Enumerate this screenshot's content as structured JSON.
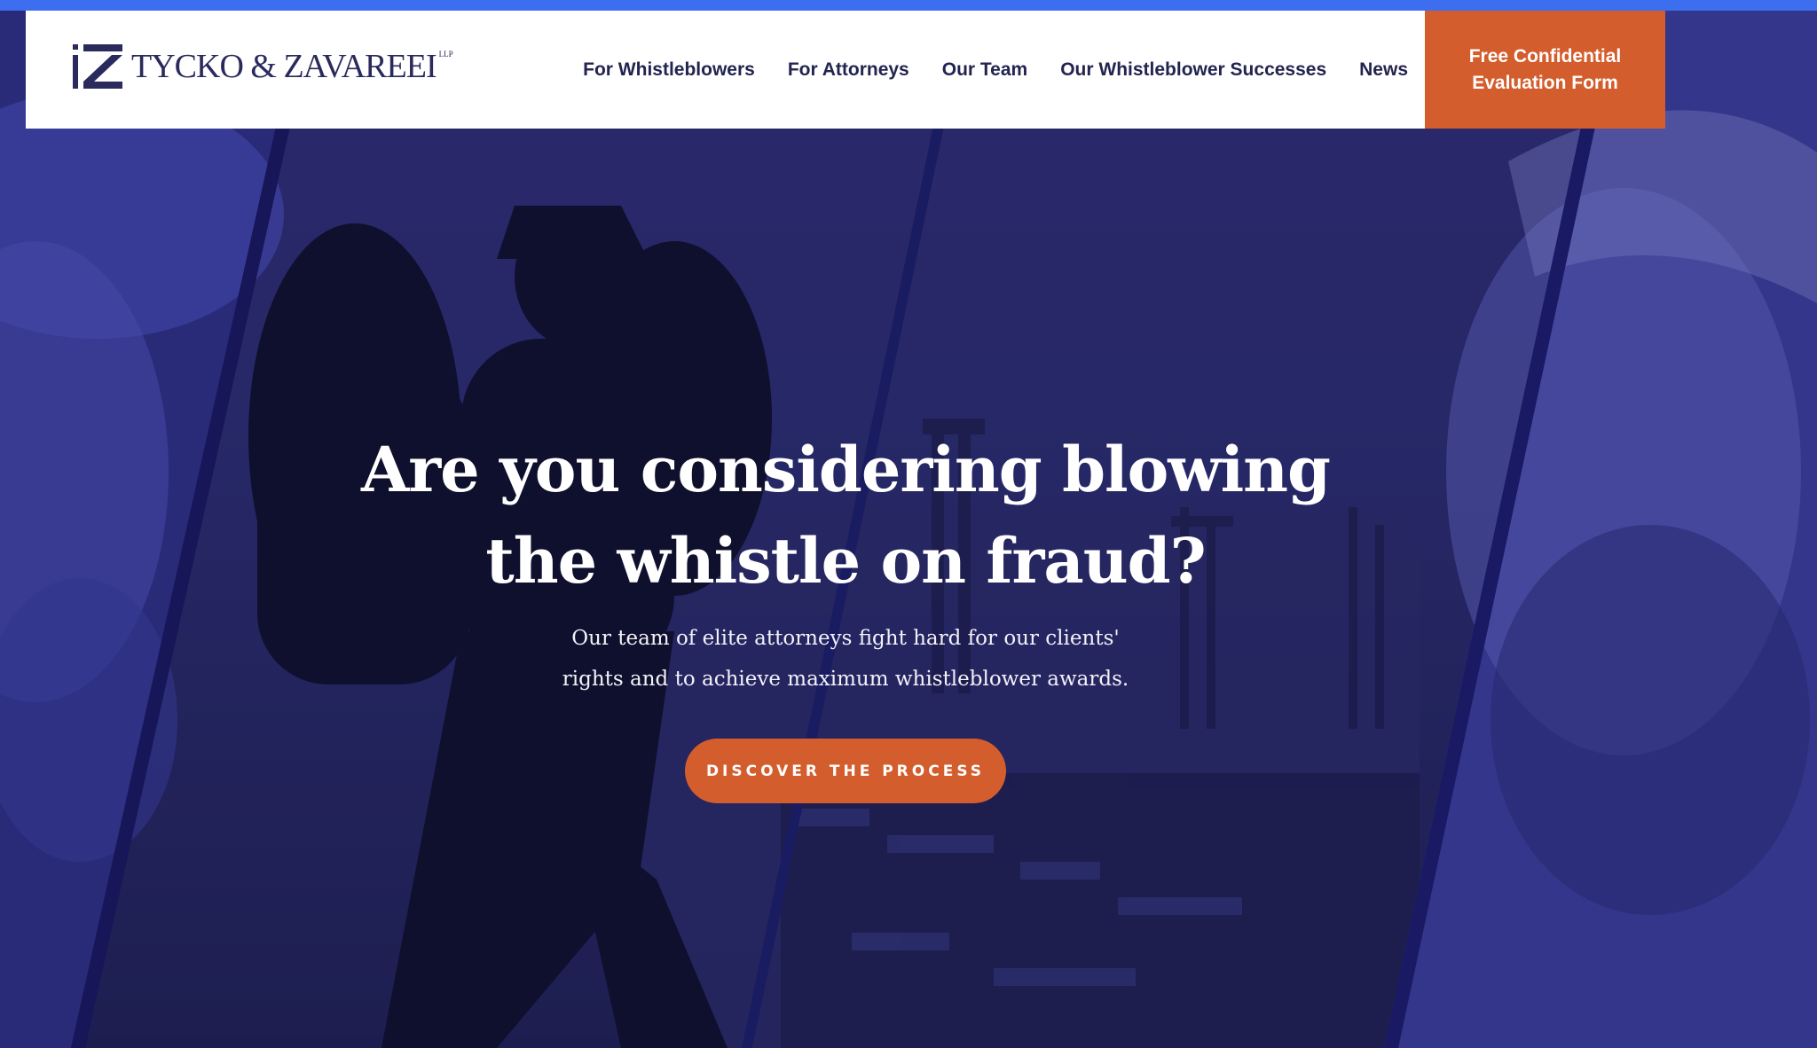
{
  "brand": {
    "name": "TYCKO & ZAVAREEI",
    "suffix": "LLP"
  },
  "nav": {
    "items": [
      {
        "label": "For Whistleblowers"
      },
      {
        "label": "For Attorneys"
      },
      {
        "label": "Our Team"
      },
      {
        "label": "Our Whistleblower Successes"
      },
      {
        "label": "News"
      }
    ],
    "cta_line1": "Free Confidential",
    "cta_line2": "Evaluation Form"
  },
  "hero": {
    "headline_line1": "Are you considering blowing",
    "headline_line2": "the whistle on fraud?",
    "sub_line1": "Our team of elite attorneys fight hard for our clients'",
    "sub_line2": "rights and to achieve maximum whistleblower awards.",
    "button_label": "DISCOVER THE PROCESS"
  },
  "colors": {
    "accent_orange": "#d45d2d",
    "navy": "#23244f",
    "hero_blue": "#2d2d75",
    "top_bar_blue": "#3d6ef0"
  }
}
